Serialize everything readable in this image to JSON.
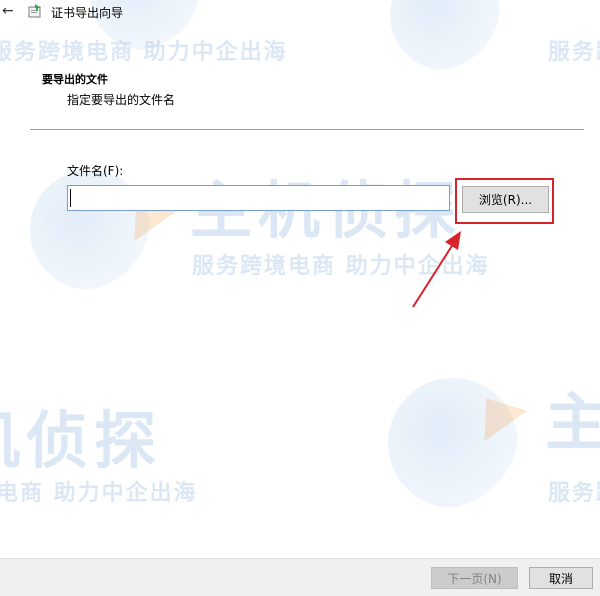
{
  "window": {
    "title": "证书导出向导"
  },
  "page": {
    "heading": "要导出的文件",
    "subheading": "指定要导出的文件名"
  },
  "form": {
    "file_label": "文件名(F):",
    "file_value": "",
    "browse_label": "浏览(R)..."
  },
  "footer": {
    "next_label": "下一页(N)",
    "cancel_label": "取消"
  },
  "watermark": {
    "brand": "主机侦探",
    "slogan": "服务跨境电商 助力中企出海"
  },
  "icons": {
    "back": "back-arrow-icon",
    "app": "certificate-wizard-icon"
  },
  "colors": {
    "highlight": "#d8232a",
    "input_border": "#7a9cc6",
    "footer_bg": "#f0f0f0",
    "watermark": "#82aadc"
  }
}
